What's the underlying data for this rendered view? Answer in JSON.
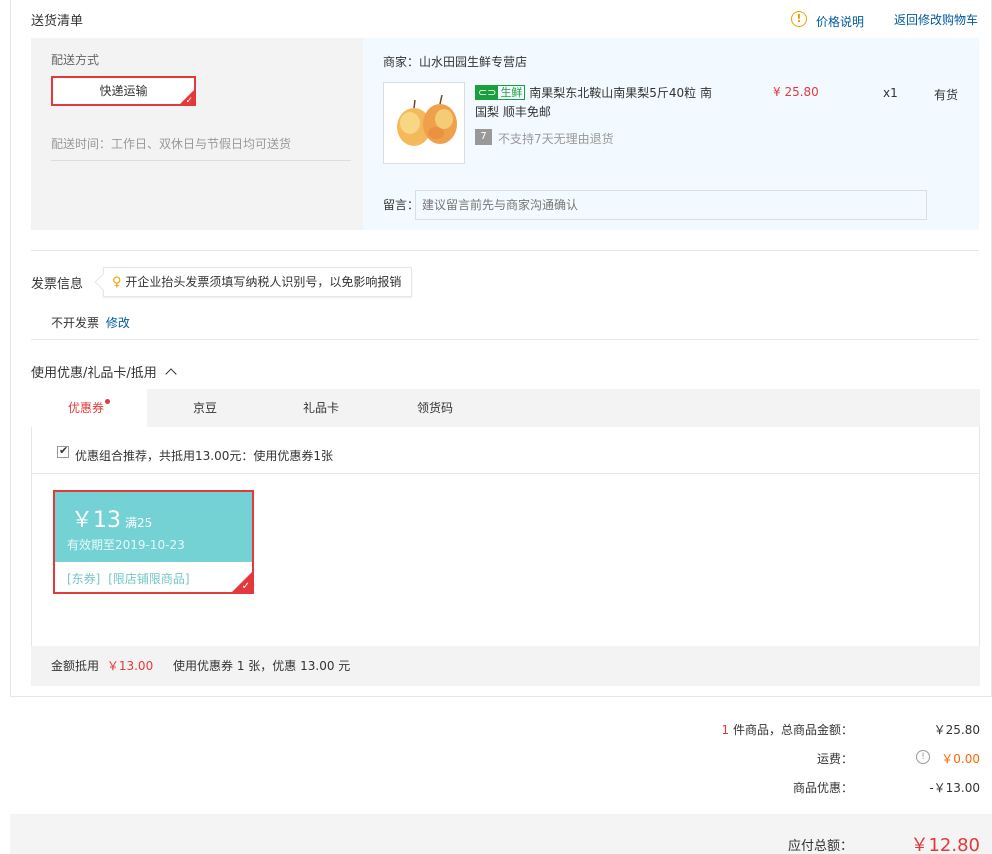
{
  "header": {
    "title": "送货清单",
    "price_note": "价格说明",
    "back_to_cart": "返回修改购物车"
  },
  "shipping": {
    "method_label": "配送方式",
    "method_value": "快递运输",
    "delivery_time": "配送时间：工作日、双休日与节假日均可送货"
  },
  "shop": {
    "merchant": "商家：山水田园生鲜专营店",
    "tag_text": "生鲜",
    "product_name_line1": "南果梨东北鞍山南果梨5斤40粒 南",
    "product_name_line2": "国梨 顺丰免邮",
    "return_policy": "不支持7天无理由退货",
    "price": "¥ 25.80",
    "qty": "x1",
    "stock": "有货",
    "message_label": "留言：",
    "message_placeholder": "建议留言前先与商家沟通确认"
  },
  "invoice": {
    "title": "发票信息",
    "tip": "开企业抬头发票须填写纳税人识别号，以免影响报销",
    "status": "不开发票",
    "edit": "修改"
  },
  "discounts": {
    "title": "使用优惠/礼品卡/抵用",
    "tabs": [
      "优惠券",
      "京豆",
      "礼品卡",
      "领货码"
    ],
    "recommend_text": "优惠组合推荐，共抵用13.00元：使用优惠券1张",
    "coupon": {
      "amount": "￥13",
      "condition": "满25",
      "validity": "有效期至2019-10-23",
      "type": "[东券]",
      "scope": "[限店铺限商品]"
    },
    "summary_label": "金额抵用",
    "summary_amount": "￥13.00",
    "summary_detail": "使用优惠券 1 张，优惠 13.00 元"
  },
  "totals": {
    "item_count": "1",
    "item_label": "件商品，总商品金额：",
    "item_total": "￥25.80",
    "shipping_label": "运费：",
    "shipping_value": "￥0.00",
    "discount_label": "商品优惠：",
    "discount_value": "-￥13.00",
    "payable_label": "应付总额：",
    "payable_value": "￥12.80"
  },
  "colors": {
    "accent_red": "#e4393c",
    "link_blue": "#005aa0",
    "coupon_teal": "#74d2d4",
    "fresh_green": "#1aa03d"
  }
}
